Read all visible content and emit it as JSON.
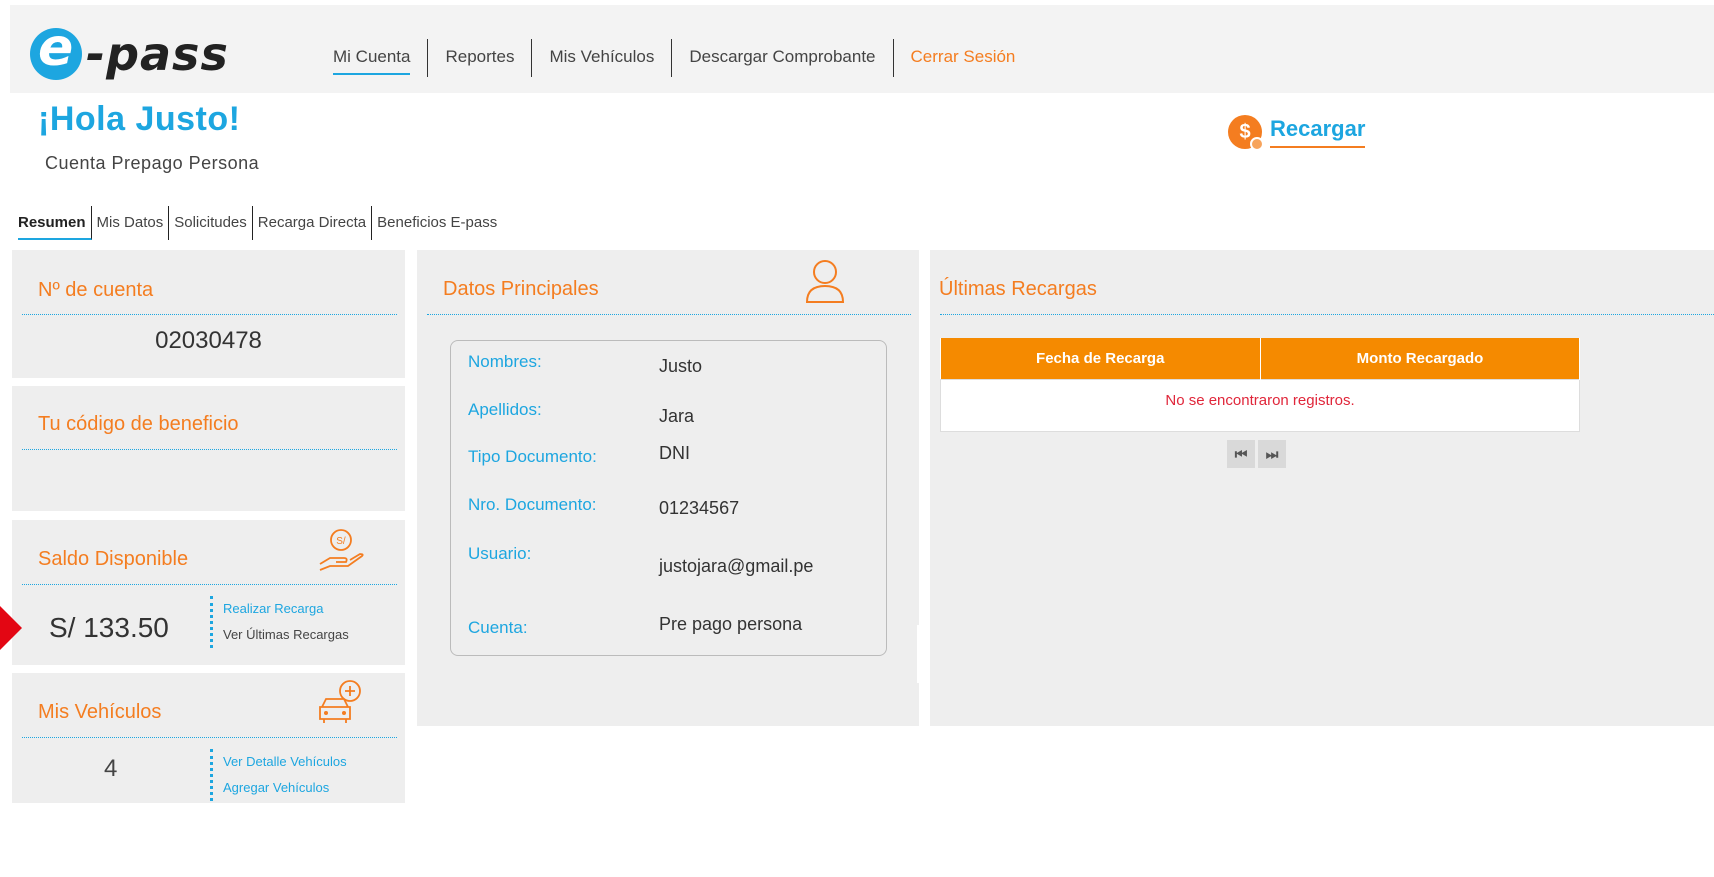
{
  "logo": {
    "letter": "e",
    "text": "-pass"
  },
  "nav": [
    {
      "label": "Mi Cuenta",
      "active": true
    },
    {
      "label": "Reportes"
    },
    {
      "label": "Mis Vehículos"
    },
    {
      "label": "Descargar Comprobante"
    },
    {
      "label": "Cerrar Sesión"
    }
  ],
  "header": {
    "greeting": "¡Hola Justo!",
    "account_type": "Cuenta Prepago Persona"
  },
  "recharge": {
    "icon_glyph": "$",
    "label": "Recargar"
  },
  "tabs": [
    "Resumen",
    "Mis Datos",
    "Solicitudes",
    "Recarga Directa",
    "Beneficios E-pass"
  ],
  "account_card": {
    "title": "Nº de cuenta",
    "number": "02030478"
  },
  "benefit_card": {
    "title": "Tu código de beneficio"
  },
  "balance_card": {
    "title": "Saldo Disponible",
    "value": "S/ 133.50",
    "links": [
      "Realizar Recarga",
      "Ver Últimas Recargas"
    ]
  },
  "vehicles_card": {
    "title": "Mis Vehículos",
    "count": "4",
    "links": [
      "Ver Detalle Vehículos",
      "Agregar Vehículos"
    ]
  },
  "main_data": {
    "title": "Datos Principales",
    "rows": [
      {
        "label": "Nombres:",
        "value": "Justo"
      },
      {
        "label": "Apellidos:",
        "value": "Jara"
      },
      {
        "label": "Tipo Documento:",
        "value": "DNI"
      },
      {
        "label": "Nro. Documento:",
        "value": "01234567"
      },
      {
        "label": "Usuario:",
        "value": "justojara@gmail.pe"
      },
      {
        "label": "Cuenta:",
        "value": "Pre pago persona"
      }
    ]
  },
  "last_recharges": {
    "title": "Últimas Recargas",
    "columns": [
      "Fecha de Recarga",
      "Monto Recargado"
    ],
    "empty_message": "No se encontraron registros.",
    "pager": [
      "⏮",
      "⏭"
    ]
  },
  "colors": {
    "accent_blue": "#1da6e0",
    "accent_orange": "#f47d20",
    "table_header": "#f58a00",
    "error_red": "#e0263a",
    "card_bg": "#eeeeee"
  }
}
